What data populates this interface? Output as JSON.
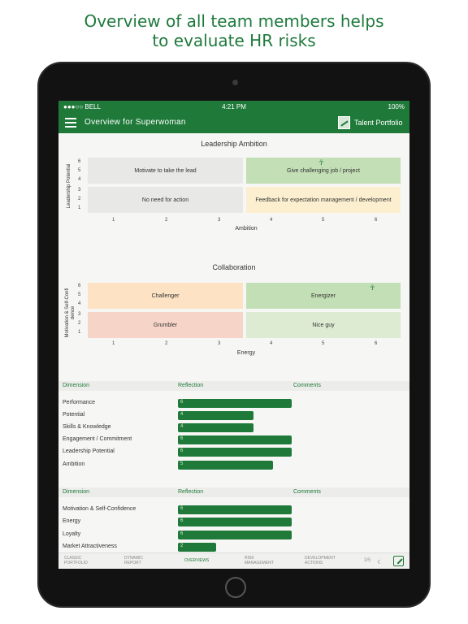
{
  "promo": {
    "line1": "Overview of all team members helps",
    "line2": "to evaluate HR risks"
  },
  "statusbar": {
    "carrier": "●●●○○ BELL",
    "time": "4:21 PM",
    "battery": "100%"
  },
  "navbar": {
    "title": "Overview for Superwoman",
    "talent_portfolio": "Talent Portfolio",
    "menu_icon": "hamburger-icon",
    "portfolio_icon": "portfolio-icon"
  },
  "leadership": {
    "title": "Leadership Ambition",
    "ylabel": "Leadership Potential",
    "xlabel": "Ambition",
    "yticks": [
      "6",
      "5",
      "4",
      "3",
      "2",
      "1"
    ],
    "xticks": [
      "1",
      "2",
      "3",
      "4",
      "5",
      "6"
    ],
    "cells": {
      "top_left": "Motivate to take the lead",
      "top_right": "Give challenging job / project",
      "bottom_left": "No need for action",
      "bottom_right": "Feedback for expectation management / development"
    },
    "marker_icon": "person-icon"
  },
  "collaboration": {
    "title": "Collaboration",
    "ylabel": "Motivation & Self-Confi dence",
    "xlabel": "Energy",
    "yticks": [
      "6",
      "5",
      "4",
      "3",
      "2",
      "1"
    ],
    "xticks": [
      "1",
      "2",
      "3",
      "4",
      "5",
      "6"
    ],
    "cells": {
      "top_left": "Challenger",
      "top_right": "Energizer",
      "bottom_left": "Grumbler",
      "bottom_right": "Nice guy"
    },
    "marker_icon": "person-icon"
  },
  "table1": {
    "headers": [
      "Dimension",
      "Reflection",
      "Comments"
    ],
    "rows": [
      {
        "label": "Performance",
        "value": "6"
      },
      {
        "label": "Potential",
        "value": "4"
      },
      {
        "label": "Skills & Knowledge",
        "value": "4"
      },
      {
        "label": "Engagement / Commitment",
        "value": "6"
      },
      {
        "label": "Leadership Potential",
        "value": "6"
      },
      {
        "label": "Ambition",
        "value": "5"
      }
    ]
  },
  "table2": {
    "headers": [
      "Dimension",
      "Reflection",
      "Comments"
    ],
    "rows": [
      {
        "label": "Motivation & Self-Confidence",
        "value": "6"
      },
      {
        "label": "Energy",
        "value": "6"
      },
      {
        "label": "Loyalty",
        "value": "6"
      },
      {
        "label": "Market Attractiveness",
        "value": "2"
      }
    ]
  },
  "bottombar": {
    "tabs": [
      {
        "line1": "CLASSIC",
        "line2": "PORTFOLIO",
        "active": false
      },
      {
        "line1": "DYNAMIC",
        "line2": "REPORT",
        "active": false
      },
      {
        "line1": "OVERVIEWS",
        "line2": "",
        "active": true
      },
      {
        "line1": "RISK",
        "line2": "MANAGEMENT",
        "active": false
      },
      {
        "line1": "DEVELOPMENT",
        "line2": "ACTIONS",
        "active": false
      }
    ],
    "page_indicator": "3/5",
    "back_icon": "chevron-left-icon",
    "share_icon": "share-icon"
  },
  "colors": {
    "brand_green": "#1f7a3a",
    "promo_green": "#1e7a3c"
  }
}
